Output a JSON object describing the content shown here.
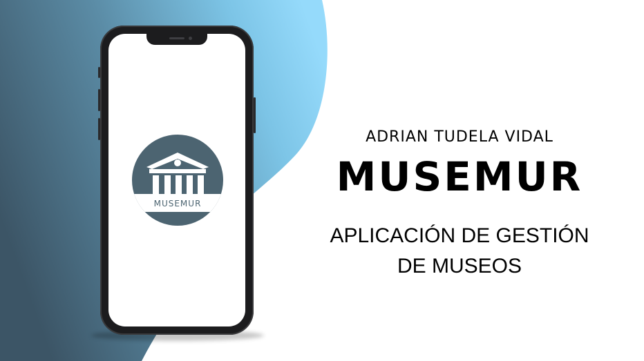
{
  "slide": {
    "author": "ADRIAN TUDELA VIDAL",
    "title": "MUSEMUR",
    "subtitle_line1": "APLICACIÓN DE GESTIÓN",
    "subtitle_line2": "DE MUSEOS"
  },
  "logo": {
    "text": "MUSEMUR",
    "icon": "museum-building-icon"
  },
  "colors": {
    "logo_circle": "#4c6471",
    "bg_dark": "#3f5a6b",
    "bg_mid": "#5a8aa3",
    "bg_light": "#8fd6f6",
    "text": "#000000"
  }
}
